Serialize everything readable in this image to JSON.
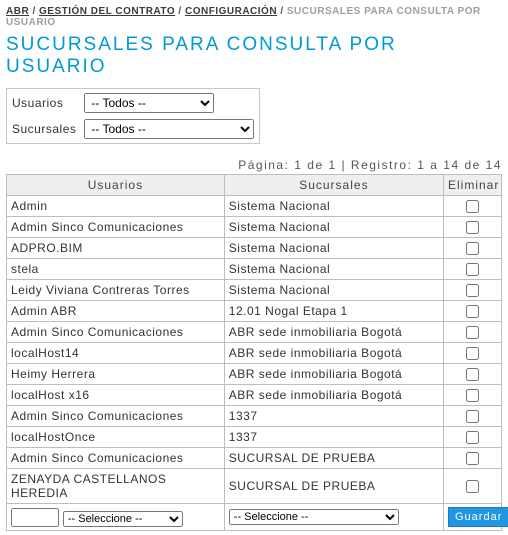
{
  "breadcrumb": {
    "items": [
      "ABR",
      "GESTIÓN DEL CONTRATO",
      "CONFIGURACIÓN"
    ],
    "current": "SUCURSALES PARA CONSULTA POR USUARIO"
  },
  "title": "SUCURSALES PARA CONSULTA POR USUARIO",
  "filters": {
    "user_label": "Usuarios",
    "branch_label": "Sucursales",
    "user_selected": "-- Todos --",
    "branch_selected": "-- Todos --"
  },
  "pager": "Página: 1 de 1  |  Registro: 1 a 14 de 14",
  "grid": {
    "headers": {
      "user": "Usuarios",
      "branch": "Sucursales",
      "delete": "Eliminar"
    },
    "rows": [
      {
        "user": "Admin",
        "branch": "Sistema Nacional"
      },
      {
        "user": "Admin Sinco Comunicaciones",
        "branch": "Sistema Nacional"
      },
      {
        "user": "ADPRO.BIM",
        "branch": "Sistema Nacional"
      },
      {
        "user": "stela",
        "branch": "Sistema Nacional"
      },
      {
        "user": "Leidy Viviana Contreras Torres",
        "branch": "Sistema Nacional"
      },
      {
        "user": "Admin ABR",
        "branch": "12.01 Nogal Etapa 1"
      },
      {
        "user": "Admin Sinco Comunicaciones",
        "branch": "ABR sede inmobiliaria Bogotá"
      },
      {
        "user": "localHost14",
        "branch": "ABR sede inmobiliaria Bogotá"
      },
      {
        "user": "Heimy Herrera",
        "branch": "ABR sede inmobiliaria Bogotá"
      },
      {
        "user": "localHost x16",
        "branch": "ABR sede inmobiliaria Bogotá"
      },
      {
        "user": "Admin Sinco Comunicaciones",
        "branch": "1337"
      },
      {
        "user": "localHostOnce",
        "branch": "1337"
      },
      {
        "user": "Admin Sinco Comunicaciones",
        "branch": "SUCURSAL DE PRUEBA"
      },
      {
        "user": "ZENAYDA CASTELLANOS HEREDIA",
        "branch": "SUCURSAL DE PRUEBA"
      }
    ],
    "footer": {
      "blank_value": "",
      "user_select": "-- Seleccione --",
      "branch_select": "-- Seleccione --",
      "save_label": "Guardar"
    }
  }
}
